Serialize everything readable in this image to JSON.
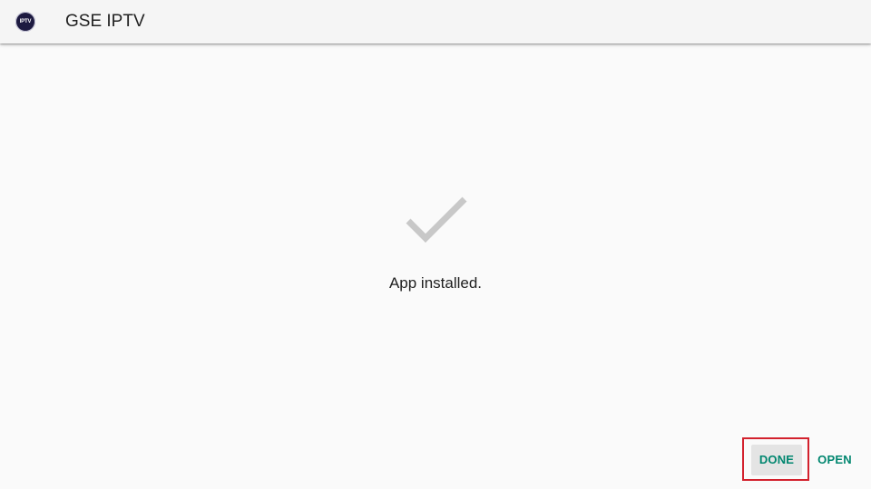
{
  "header": {
    "app_icon_text": "IPTV",
    "app_icon": "gse-iptv-logo",
    "title": "GSE IPTV"
  },
  "main": {
    "status_icon": "checkmark-icon",
    "status_text": "App installed."
  },
  "actions": {
    "done_label": "DONE",
    "open_label": "OPEN"
  },
  "colors": {
    "background": "#fafafa",
    "app_bar": "#f5f5f5",
    "accent": "#00866f",
    "check": "#c8c8c8",
    "highlight_box": "#d3212d"
  }
}
